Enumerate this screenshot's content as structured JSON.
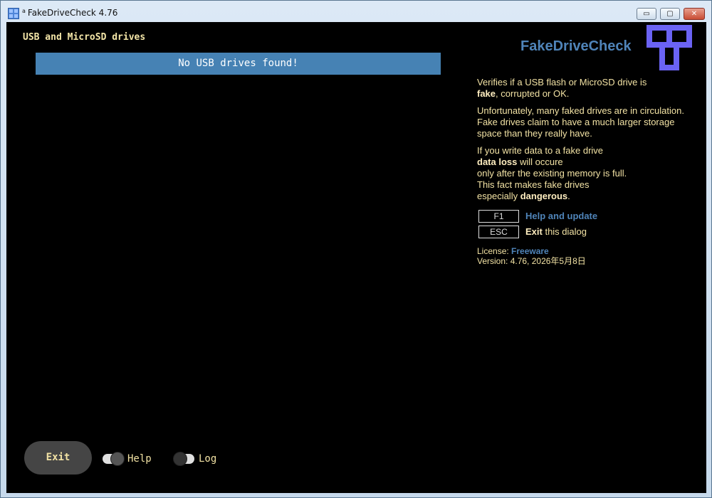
{
  "window": {
    "title": "FakeDriveCheck 4.76",
    "title_mark": "a",
    "buttons": {
      "minimize": "▭",
      "maximize": "▢",
      "close": "✕"
    }
  },
  "drives": {
    "heading": "USB and MicroSD drives",
    "empty_message": "No USB drives found!"
  },
  "brand": {
    "name": "FakeDriveCheck",
    "accent_color": "#4f84b9",
    "logo_color": "#6b63f4"
  },
  "info": {
    "p1_a": "Verifies if a USB flash or MicroSD drive is",
    "p1_bold": "fake",
    "p1_b": ", corrupted or OK.",
    "p2": "Unfortunately, many faked drives are in circulation. Fake drives claim to have a much larger storage space than they really have.",
    "p3_l1": "If you write data to a fake drive",
    "p3_bold": "data loss",
    "p3_l2": " will occure",
    "p3_l3": "only after the existing memory is full.",
    "p3_l4": "This fact makes fake drives",
    "p3_l5a": "especially ",
    "p3_bold2": "dangerous",
    "p3_l5b": "."
  },
  "shortcuts": [
    {
      "key": "F1",
      "label": "Help and update"
    },
    {
      "key": "ESC",
      "bold": "Exit",
      "rest": " this dialog"
    }
  ],
  "license": {
    "label": "License: ",
    "value": "Freeware",
    "version_line": "Version: 4.76, 2026年5月8日"
  },
  "footer": {
    "exit_label": "Exit",
    "toggles": [
      {
        "label": "Help",
        "on": true
      },
      {
        "label": "Log",
        "on": false
      }
    ]
  }
}
